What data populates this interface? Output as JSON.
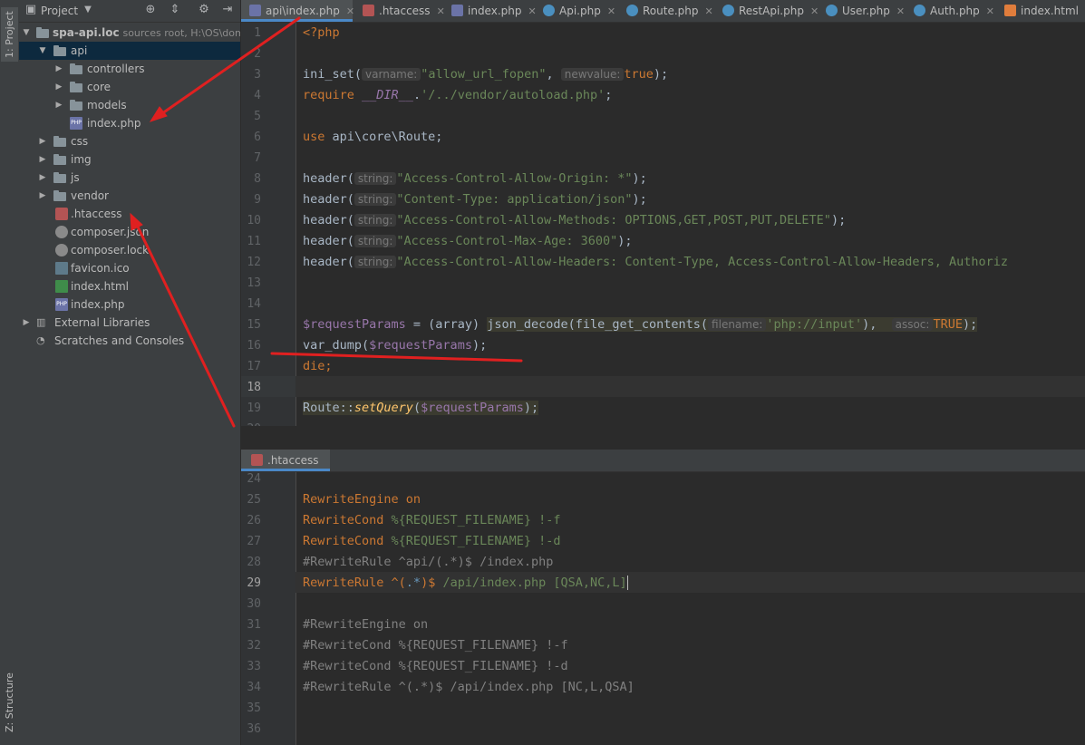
{
  "tool_strip": {
    "project_tab": "1: Project",
    "structure_tab": "Z: Structure"
  },
  "project_panel": {
    "title": "Project",
    "root": {
      "name": "spa-api.loc",
      "info": "sources root,  H:\\OS\\doma"
    },
    "items": [
      {
        "label": "api"
      },
      {
        "label": "controllers"
      },
      {
        "label": "core"
      },
      {
        "label": "models"
      },
      {
        "label": "index.php"
      },
      {
        "label": "css"
      },
      {
        "label": "img"
      },
      {
        "label": "js"
      },
      {
        "label": "vendor"
      },
      {
        "label": ".htaccess"
      },
      {
        "label": "composer.json"
      },
      {
        "label": "composer.lock"
      },
      {
        "label": "favicon.ico"
      },
      {
        "label": "index.html"
      },
      {
        "label": "index.php"
      },
      {
        "label": "External Libraries"
      },
      {
        "label": "Scratches and Consoles"
      }
    ]
  },
  "editor_tabs": [
    {
      "label": "api\\index.php"
    },
    {
      "label": ".htaccess"
    },
    {
      "label": "index.php"
    },
    {
      "label": "Api.php"
    },
    {
      "label": "Route.php"
    },
    {
      "label": "RestApi.php"
    },
    {
      "label": "User.php"
    },
    {
      "label": "Auth.php"
    },
    {
      "label": "index.html"
    }
  ],
  "top_editor": {
    "line_numbers": [
      "1",
      "2",
      "3",
      "4",
      "5",
      "6",
      "7",
      "8",
      "9",
      "10",
      "11",
      "12",
      "13",
      "14",
      "15",
      "16",
      "17",
      "18",
      "19",
      "20"
    ],
    "lines": {
      "l1": "<?php",
      "l3a": "ini_set(",
      "l3h1": "varname:",
      "l3s1": "\"allow_url_fopen\"",
      "l3c": ",",
      "l3h2": "newvalue:",
      "l3k": "true",
      "l3e": ");",
      "l4k": "require ",
      "l4d": "__DIR__",
      "l4p": ".",
      "l4s": "'/../vendor/autoload.php'",
      "l4e": ";",
      "l6k": "use ",
      "l6r": "api\\core\\Route;",
      "h_call": "header(",
      "h_hint": "string:",
      "l8s": "\"Access-Control-Allow-Origin: *\"",
      "l9s": "\"Content-Type: application/json\"",
      "l10s": "\"Access-Control-Allow-Methods: OPTIONS,GET,POST,PUT,DELETE\"",
      "l11s": "\"Access-Control-Max-Age: 3600\"",
      "l12s": "\"Access-Control-Allow-Headers: Content-Type, Access-Control-Allow-Headers, Authoriz",
      "h_end": ");",
      "l15v": "$requestParams",
      "l15o": " = (array) ",
      "l15f": "json_decode(file_get_contents(",
      "l15h1": "filename:",
      "l15s": "'php://input'",
      "l15c": "),",
      "l15h2": "assoc:",
      "l15k": "TRUE",
      "l15e": ");",
      "l16a": "var_dump(",
      "l16v": "$requestParams",
      "l16e": ");",
      "l17": "die;",
      "l19a": "Route::",
      "l19f": "setQuery",
      "l19b": "(",
      "l19v": "$requestParams",
      "l19e": ");"
    }
  },
  "bottom_tab": {
    "label": ".htaccess"
  },
  "bottom_editor": {
    "line_numbers": [
      "24",
      "25",
      "26",
      "27",
      "28",
      "29",
      "30",
      "31",
      "32",
      "33",
      "34",
      "35",
      "36"
    ],
    "lines": {
      "b25k": "RewriteEngine",
      "b25v": " on",
      "b26k": "RewriteCond",
      "b26v": " %{REQUEST_FILENAME} !-f",
      "b27k": "RewriteCond",
      "b27v": " %{REQUEST_FILENAME} !-d",
      "b28": "#RewriteRule ^api/(.*)$ /index.php",
      "b29k": "RewriteRule",
      "b29a": " ^(",
      "b29b": ".*",
      "b29c": ")$",
      "b29d": " /api/index.php [QSA,NC,L]",
      "b31": "#RewriteEngine on",
      "b32": "#RewriteCond %{REQUEST_FILENAME} !-f",
      "b33": "#RewriteCond %{REQUEST_FILENAME} !-d",
      "b34": "#RewriteRule ^(.*)$ /api/index.php [NC,L,QSA]"
    }
  },
  "colors": {
    "accent": "#4a88c7",
    "annotation": "#e02020",
    "keyword": "#cc7832",
    "string": "#6a8759",
    "variable": "#9876aa"
  }
}
